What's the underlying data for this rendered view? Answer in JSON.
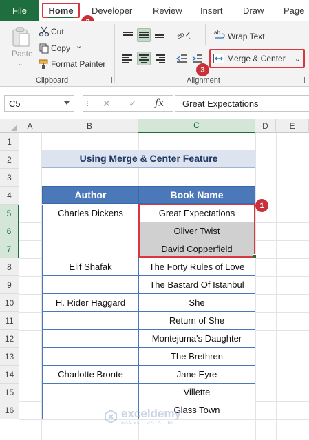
{
  "ribbon_tabs": {
    "file": "File",
    "home": "Home",
    "developer": "Developer",
    "review": "Review",
    "insert": "Insert",
    "draw": "Draw",
    "page": "Page"
  },
  "clipboard": {
    "paste": "Paste",
    "cut": "Cut",
    "copy": "Copy",
    "format_painter": "Format Painter",
    "group_label": "Clipboard"
  },
  "alignment": {
    "wrap_text": "Wrap Text",
    "merge_center": "Merge & Center",
    "group_label": "Alignment"
  },
  "badges": {
    "one": "1",
    "two": "2",
    "three": "3"
  },
  "formula_bar": {
    "name_box": "C5",
    "cancel_symbol": "✕",
    "enter_symbol": "✓",
    "fx_symbol": "fx",
    "formula": "Great Expectations"
  },
  "columns": [
    "A",
    "B",
    "C",
    "D",
    "E"
  ],
  "rows": [
    "1",
    "2",
    "3",
    "4",
    "5",
    "6",
    "7",
    "8",
    "9",
    "10",
    "11",
    "12",
    "13",
    "14",
    "15",
    "16"
  ],
  "sheet": {
    "title": "Using Merge & Center Feature",
    "headers": {
      "author": "Author",
      "book": "Book Name"
    },
    "rows": [
      {
        "author": "Charles Dickens",
        "book": "Great Expectations"
      },
      {
        "author": "",
        "book": "Oliver Twist"
      },
      {
        "author": "",
        "book": "David Copperfield"
      },
      {
        "author": "Elif Shafak",
        "book": "The Forty Rules of Love"
      },
      {
        "author": "",
        "book": "The Bastard Of Istanbul"
      },
      {
        "author": "H. Rider Haggard",
        "book": "She"
      },
      {
        "author": "",
        "book": "Return of She"
      },
      {
        "author": "",
        "book": "Montejuma's Daughter"
      },
      {
        "author": "",
        "book": "The Brethren"
      },
      {
        "author": "Charlotte Bronte",
        "book": "Jane Eyre"
      },
      {
        "author": "",
        "book": "Villette"
      },
      {
        "author": "",
        "book": "Glass Town"
      }
    ]
  },
  "watermark": {
    "name": "exceldemy",
    "tagline": "EXCEL · DATA · BI"
  },
  "colors": {
    "excel_green": "#1e6e3f",
    "highlight_red": "#d9363e",
    "table_header": "#4a78b8"
  }
}
